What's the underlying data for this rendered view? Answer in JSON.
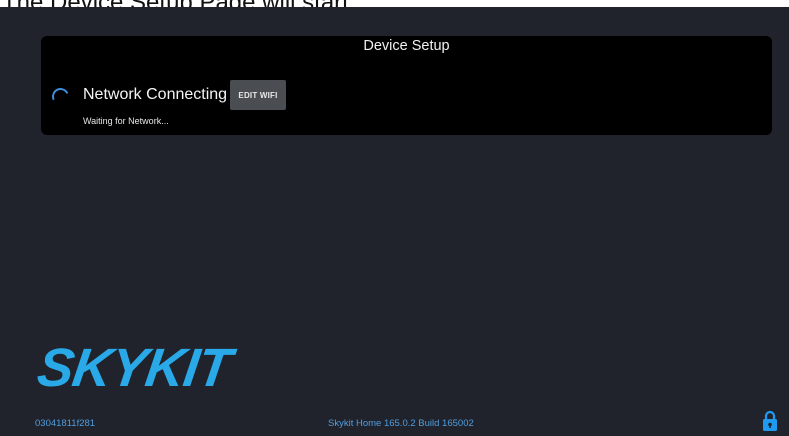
{
  "caption": "The Device Setup Page will start.",
  "card": {
    "title": "Device Setup",
    "status": "Network Connecting",
    "edit_wifi_label": "EDIT WIFI",
    "sub_status": "Waiting for Network..."
  },
  "logo": {
    "text": "SKYKIT"
  },
  "footer": {
    "device_id": "03041811f281",
    "version": "Skykit Home 165.0.2 Build 165002"
  },
  "icons": {
    "spinner": "loading-spinner-icon",
    "lock": "lock-icon"
  },
  "colors": {
    "background": "#20232b",
    "card": "#000000",
    "accent": "#29a9e8",
    "footer_text": "#4f9ee0",
    "lock": "#1e9bf0"
  }
}
